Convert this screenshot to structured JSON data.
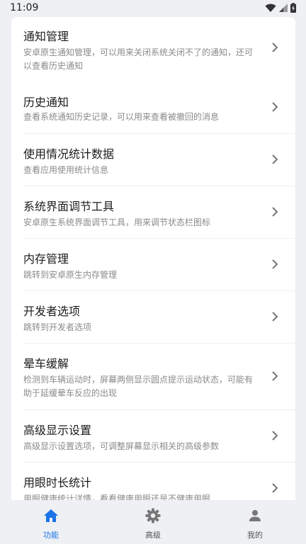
{
  "status_bar": {
    "time": "11:09"
  },
  "items": [
    {
      "title": "通知管理",
      "desc": "安卓原生通知管理，可以用来关闭系统关闭不了的通知，还可以查看历史通知"
    },
    {
      "title": "历史通知",
      "desc": "查看系统通知历史记录，可以用来查看被撤回的消息"
    },
    {
      "title": "使用情况统计数据",
      "desc": "查看应用使用统计信息"
    },
    {
      "title": "系统界面调节工具",
      "desc": "安卓原生系统界面调节工具，用来调节状态栏图标"
    },
    {
      "title": "内存管理",
      "desc": "跳转到安卓原生内存管理"
    },
    {
      "title": "开发者选项",
      "desc": "跳转到开发者选项"
    },
    {
      "title": "晕车缓解",
      "desc": "检测到车辆运动时，屏幕两侧显示圆点提示运动状态，可能有助于延缓晕车反应的出现"
    },
    {
      "title": "高级显示设置",
      "desc": "高级显示设置选项，可调整屏幕显示相关的高级参数"
    },
    {
      "title": "用眼时长统计",
      "desc": "用眼健康统计详情，看看健康用眼还是不健康用眼"
    }
  ],
  "bottom_nav": {
    "tabs": [
      {
        "label": "功能",
        "icon": "home-icon",
        "active": true
      },
      {
        "label": "高级",
        "icon": "gear-icon",
        "active": false
      },
      {
        "label": "我的",
        "icon": "person-icon",
        "active": false
      }
    ],
    "active_color": "#1a73e8",
    "inactive_color": "#777777"
  }
}
